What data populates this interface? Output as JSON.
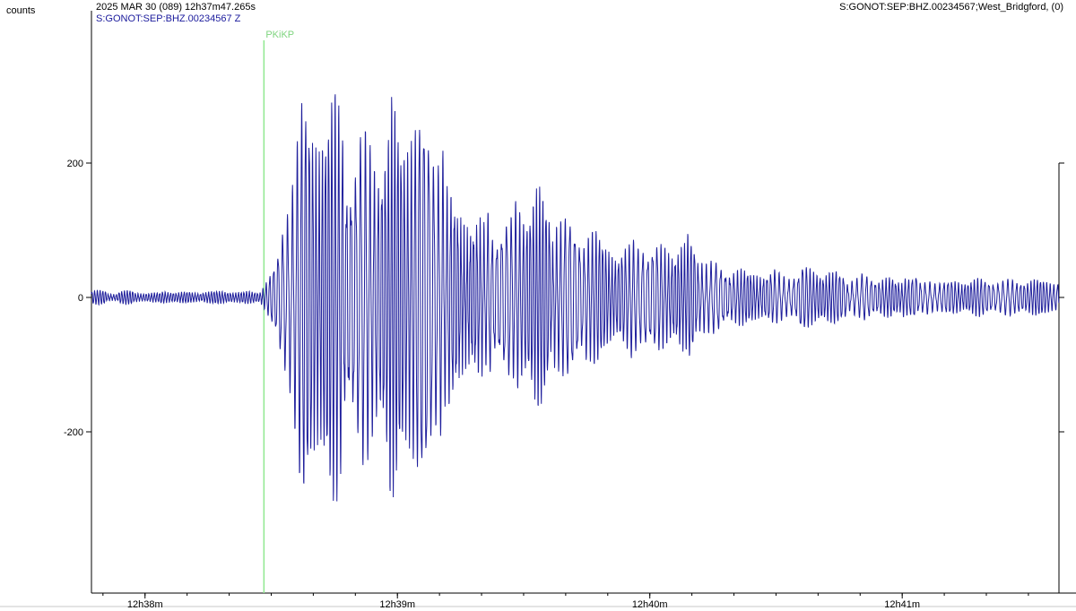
{
  "header": {
    "units": "counts",
    "datetime": "2025 MAR 30 (089)  12h37m47.265s",
    "channel": "S:GONOT:SEP:BHZ.00234567 Z",
    "station_info": "S:GONOT:SEP:BHZ.00234567;West_Bridgford, (0)"
  },
  "colors": {
    "trace": "#1f1f9c",
    "phase_marker": "#90e890",
    "phase_label": "#7ed47e",
    "axis": "#000000"
  },
  "chart_data": {
    "type": "line",
    "title": "",
    "xlabel": "",
    "ylabel": "counts",
    "xlim": [
      "12h37m47.265s",
      "12h41m37s"
    ],
    "ylim": [
      -440,
      440
    ],
    "y_ticks": [
      {
        "value": 200,
        "label": "200"
      },
      {
        "value": 0,
        "label": "0"
      },
      {
        "value": -200,
        "label": "-200"
      }
    ],
    "x_ticks": [
      {
        "label": "12h38m"
      },
      {
        "label": "12h39m"
      },
      {
        "label": "12h40m"
      },
      {
        "label": "12h41m"
      }
    ],
    "phase": {
      "name": "PKiKP",
      "time_s": 41
    },
    "series": [
      {
        "description": "vertical-component seismogram; amplitude envelope (counts) vs seconds after 12h37m47.265s",
        "envelope": [
          {
            "t": 0,
            "amp": 10
          },
          {
            "t": 40,
            "amp": 10
          },
          {
            "t": 44,
            "amp": 60
          },
          {
            "t": 50,
            "amp": 330
          },
          {
            "t": 56,
            "amp": 300
          },
          {
            "t": 68,
            "amp": 310
          },
          {
            "t": 80,
            "amp": 300
          },
          {
            "t": 96,
            "amp": 140
          },
          {
            "t": 110,
            "amp": 160
          },
          {
            "t": 125,
            "amp": 80
          },
          {
            "t": 138,
            "amp": 110
          },
          {
            "t": 155,
            "amp": 55
          },
          {
            "t": 180,
            "amp": 40
          },
          {
            "t": 230,
            "amp": 25
          }
        ]
      }
    ]
  }
}
